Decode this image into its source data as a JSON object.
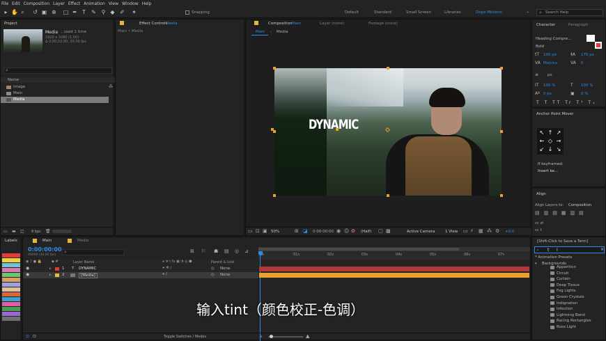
{
  "menu": [
    "File",
    "Edit",
    "Composition",
    "Layer",
    "Effect",
    "Animation",
    "View",
    "Window",
    "Help"
  ],
  "toolbar": {
    "snapping": "Snapping",
    "workspaces": [
      "Default",
      "Standard",
      "Small Screen",
      "Libraries",
      "Dope Motions"
    ],
    "active_workspace": "Dope Motions",
    "search_placeholder": "Search Help"
  },
  "project": {
    "title": "Project",
    "item_name": "Media",
    "used": ", used 1 time",
    "info1": "1920 x 1080 (1.00)",
    "info2": "Δ 0;00;10;00, 30.00 fps",
    "col_name": "Name",
    "items": [
      "Image",
      "Main",
      "Media"
    ],
    "bpc": "8 bpc"
  },
  "effect_controls": {
    "title": "Effect Controls",
    "title_name": "Media",
    "breadcrumb": "Main • Media"
  },
  "comp": {
    "tab_label": "Composition",
    "tab_name": "Main",
    "layer_tab": "Layer (none)",
    "footage_tab": "Footage (none)",
    "sub_tabs": [
      "Main",
      "Media"
    ],
    "overlay_text": "DYNAMIC",
    "zoom": "50%",
    "timecode": "0:00:00:00",
    "resolution": "(Half)",
    "camera": "Active Camera",
    "view": "1 View",
    "exposure": "+0.0"
  },
  "character": {
    "title": "Character",
    "tab2": "Paragraph",
    "font": "Heading Compre...",
    "style": "Bold",
    "size": "100 px",
    "leading": "170 px",
    "kerning": "Metrics",
    "tracking": "0",
    "stroke": "px",
    "vscale": "100 %",
    "hscale": "100 %",
    "baseline": "0 px",
    "tsume": "0 %"
  },
  "anchor": {
    "title": "Anchor Point Mover",
    "if_keyframed": "If keyframed:",
    "insert": "Insert ke..."
  },
  "align": {
    "title": "Align",
    "align_to_label": "Align Layers to:",
    "align_to_value": "Composition"
  },
  "cc": [
    "cc st",
    "cc t"
  ],
  "effects_presets": {
    "hint": "[Shift-Click to Save a Term]",
    "search_value": "t",
    "root": "* Animation Presets",
    "folder": "Backgrounds",
    "items": [
      "Apparition",
      "Circuit",
      "Curtain",
      "Deep Tissue",
      "Fog Lights",
      "Green Crystals",
      "Indignation",
      "Infection",
      "Lightning Bend",
      "Racing Rectangles",
      "Rose Light"
    ]
  },
  "labels": {
    "title": "Labels",
    "colors": [
      "#e23b3b",
      "#ecd43a",
      "#78c0d8",
      "#d87ab7",
      "#6fc46f",
      "#d9a060",
      "#a0a0e0",
      "#e0c0a0",
      "#d8683a",
      "#3aa0d8",
      "#e060a0",
      "#4aa04a",
      "#9a6ad0",
      "#707070"
    ]
  },
  "timeline": {
    "tab_main": "Main",
    "tab_media": "Media",
    "timecode": "0:00:00:00",
    "fps_note": "00000 (30.00 fps)",
    "col_layer": "Layer Name",
    "col_parent": "Parent & Link",
    "layers": [
      {
        "num": "1",
        "type": "T",
        "name": "DYNAMIC",
        "parent": "None",
        "color": "#e23b3b"
      },
      {
        "num": "2",
        "type": "",
        "name": "[Media]",
        "parent": "None",
        "color": "#ecbd3a"
      }
    ],
    "ruler": [
      "0s",
      "01s",
      "02s",
      "03s",
      "04s",
      "05s",
      "06s",
      "07s"
    ],
    "toggle": "Toggle Switches / Modes"
  },
  "subtitle": "输入tint（颜色校正-色调）",
  "colors": {
    "accent": "#2d8ceb",
    "layer1_bar": "#b03838",
    "layer2_bar": "#e8a22a"
  }
}
